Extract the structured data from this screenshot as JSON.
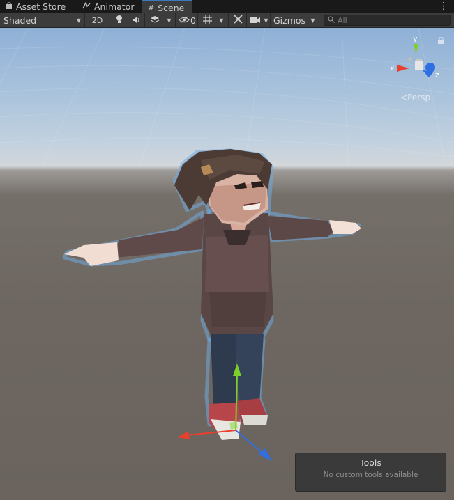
{
  "tabs": [
    {
      "label": "Asset Store",
      "icon": "shopping-bag-icon"
    },
    {
      "label": "Animator",
      "icon": "animator-icon"
    },
    {
      "label": "Scene",
      "icon": "grid-hash-icon",
      "active": true
    }
  ],
  "toolbar": {
    "shading_mode": "Shaded",
    "mode_2d": "2D",
    "hidden_count": "0",
    "gizmos": "Gizmos",
    "search_placeholder": "All"
  },
  "viewport": {
    "axis_y": "y",
    "axis_x": "x",
    "axis_z": "z",
    "projection": "Persp"
  },
  "tools_overlay": {
    "title": "Tools",
    "message": "No custom tools available"
  },
  "colors": {
    "tab_active_accent": "#3a79bb",
    "axis_x": "#e8402d",
    "axis_y": "#7bd12b",
    "axis_z": "#2f6fe0",
    "selection_outline": "#5b9bd5"
  }
}
